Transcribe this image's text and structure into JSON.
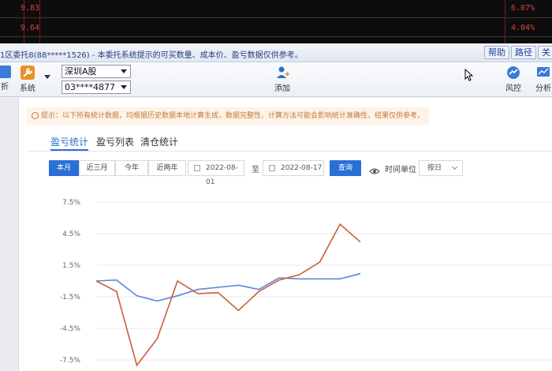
{
  "ticker": {
    "rows": [
      {
        "left": "9.83",
        "right": "6.07%"
      },
      {
        "left": "9.64",
        "right": "4.04%"
      }
    ]
  },
  "window": {
    "title": "1区委托8(88*****1526) - 本委托系统提示的可买数量、成本价、盈亏数据仅供参考。",
    "buttons": [
      "帮助",
      "路径",
      "关"
    ]
  },
  "toolbar": {
    "left_partial_label": "折",
    "system_label": "系统",
    "market_select": "深圳A股",
    "account_select": "03****4877",
    "add_label": "添加",
    "risk_label": "风控",
    "analysis_label": "分析"
  },
  "panel": {
    "notice": "提示：以下所有统计数据，均根据历史数据本地计算生成，数据完整性、计算方法可能会影响统计准确性，结果仅供参考。",
    "tabs": [
      "盈亏统计",
      "盈亏列表",
      "清仓统计"
    ],
    "active_tab": 0,
    "periods": [
      "本月",
      "近三月",
      "今年",
      "近两年"
    ],
    "active_period": 0,
    "date_from": "2022-08-01",
    "date_sep": "至",
    "date_to": "2022-08-17",
    "query_label": "查询",
    "time_unit_label": "时间单位",
    "time_unit_value": "按日"
  },
  "chart_data": {
    "type": "line",
    "ylabel": "",
    "xlabel": "",
    "yticks": [
      "7.5%",
      "4.5%",
      "1.5%",
      "-1.5%",
      "-4.5%",
      "-7.5%"
    ],
    "ylim": [
      -7.5,
      7.5
    ],
    "grid": true,
    "series": [
      {
        "color": "#5b86d8",
        "values": [
          0.0,
          0.1,
          -1.4,
          -1.9,
          -1.4,
          -0.8,
          -0.6,
          -0.4,
          -0.8,
          0.3,
          0.2,
          0.2,
          0.2,
          0.7
        ]
      },
      {
        "color": "#cf5a3c",
        "values": [
          0.0,
          -1.0,
          -8.0,
          -5.5,
          0.0,
          -1.2,
          -1.1,
          -2.8,
          -1.0,
          0.1,
          0.6,
          1.8,
          5.4,
          3.7
        ]
      }
    ]
  },
  "colors": {
    "accent": "#2a6fd6",
    "notice_text": "#c0793a",
    "notice_bg": "#fdf3e7"
  }
}
